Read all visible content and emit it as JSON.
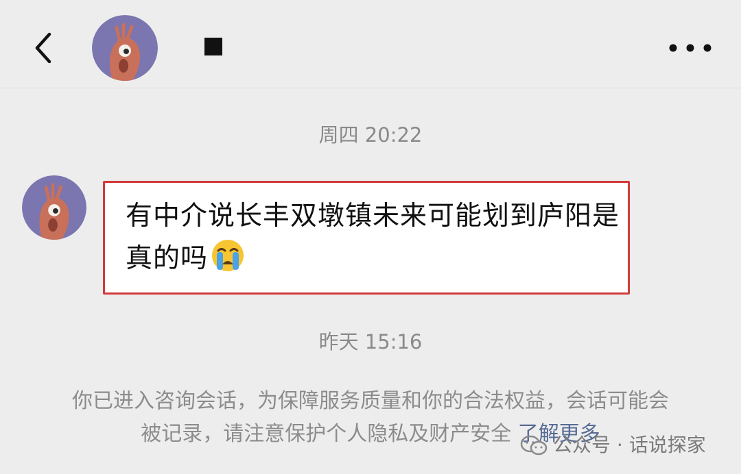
{
  "header": {
    "contact_name": "■"
  },
  "chat": {
    "timestamp_1": "周四 20:22",
    "message_text": "有中介说长丰双墩镇未来可能划到庐阳是真的吗",
    "timestamp_2": "昨天 15:16"
  },
  "notice": {
    "text": "你已进入咨询会话，为保障服务质量和你的合法权益，会话可能会被记录，请注意保护个人隐私及财产安全",
    "link_text": "了解更多"
  },
  "watermark": {
    "text": "公众号 · 话说探家"
  },
  "colors": {
    "background": "#ededed",
    "bubble_border": "#d23a3a",
    "link": "#576b95",
    "avatar_bg": "#7b75b0",
    "avatar_figure": "#c9705a"
  },
  "icons": {
    "back": "chevron-left-icon",
    "more": "more-dots-icon",
    "emoji": "crying-face-emoji"
  }
}
